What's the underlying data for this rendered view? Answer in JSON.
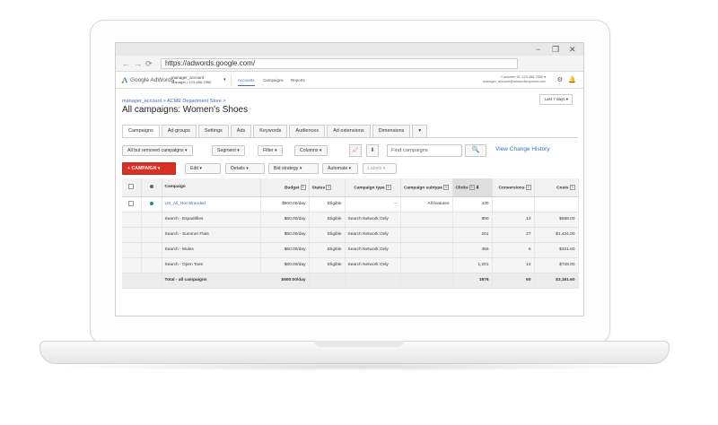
{
  "browser": {
    "url": "https://adwords.google.com/",
    "window_controls": [
      "−",
      "❐",
      "✕"
    ],
    "nav_icons": [
      "arrow-left-icon",
      "arrow-right-icon",
      "reload-icon"
    ]
  },
  "topbar": {
    "logo_text": "Google AdWords",
    "account_name": "manager_account",
    "account_sub": "Manager • 123-456-7890",
    "nav": [
      "Accounts",
      "Campaigns",
      "Reports"
    ],
    "active_nav": "Accounts",
    "customer_id": "Customer ID: 123-456-7890",
    "customer_email": "manager_account@adwordsexpress.com"
  },
  "header": {
    "breadcrumb": "manager_account > ACME Department Store >",
    "title": "All campaigns: Women's Shoes",
    "date_range": "Last 7 days"
  },
  "tabs": [
    "Campaigns",
    "Ad groups",
    "Settings",
    "Ads",
    "Keywords",
    "Audiences",
    "Ad extensions",
    "Dimensions",
    "▾"
  ],
  "active_tab": "Campaigns",
  "toolbar": {
    "filter_select": "All but removed campaigns",
    "segment": "Segment",
    "filter": "Filter",
    "columns": "Columns",
    "search_placeholder": "Find campaigns",
    "view_history": "View Change History",
    "campaign_button": "+ CAMPAIGN",
    "edit": "Edit",
    "details": "Details",
    "bid_strategy": "Bid strategy",
    "automate": "Automate",
    "labels": "Labels"
  },
  "table": {
    "headers": {
      "campaign": "Campaign",
      "budget": "Budget",
      "status": "Status",
      "campaign_type": "Campaign type",
      "campaign_subtype": "Campaign subtype",
      "clicks": "Clicks",
      "conversions": "Conversions",
      "costs": "Costs"
    },
    "rows": [
      {
        "campaign": "US_All_Non Branded",
        "budget": "$500.00/day",
        "status": "Eligible",
        "type": "--",
        "subtype": "All features",
        "clicks": "430",
        "conversions": "",
        "costs": ""
      },
      {
        "campaign": "Search - Espadrilles",
        "budget": "$60.00/day",
        "status": "Eligible",
        "type": "Search Network Only",
        "subtype": "",
        "clicks": "890",
        "conversions": "13",
        "costs": "$688.00"
      },
      {
        "campaign": "Search - Summer Flats",
        "budget": "$60.00/day",
        "status": "Eligible",
        "type": "Search Network Only",
        "subtype": "",
        "clicks": "201",
        "conversions": "27",
        "costs": "$1,424.00"
      },
      {
        "campaign": "Search - Mules",
        "budget": "$60.00/day",
        "status": "Eligible",
        "type": "Search Network Only",
        "subtype": "",
        "clicks": "455",
        "conversions": "6",
        "costs": "$321.60"
      },
      {
        "campaign": "Search - Open Toes",
        "budget": "$60.00/day",
        "status": "Eligible",
        "type": "Search Network Only",
        "subtype": "",
        "clicks": "1,201",
        "conversions": "14",
        "costs": "$728.00"
      }
    ],
    "total": {
      "campaign": "Total - all campaigns",
      "budget": "$500.00/day",
      "clicks": "1976",
      "conversions": "60",
      "costs": "$3,161.60"
    }
  },
  "colors": {
    "accent": "#3a6fc5",
    "primary_button": "#d93025",
    "status_dot": "#0f9d58"
  }
}
